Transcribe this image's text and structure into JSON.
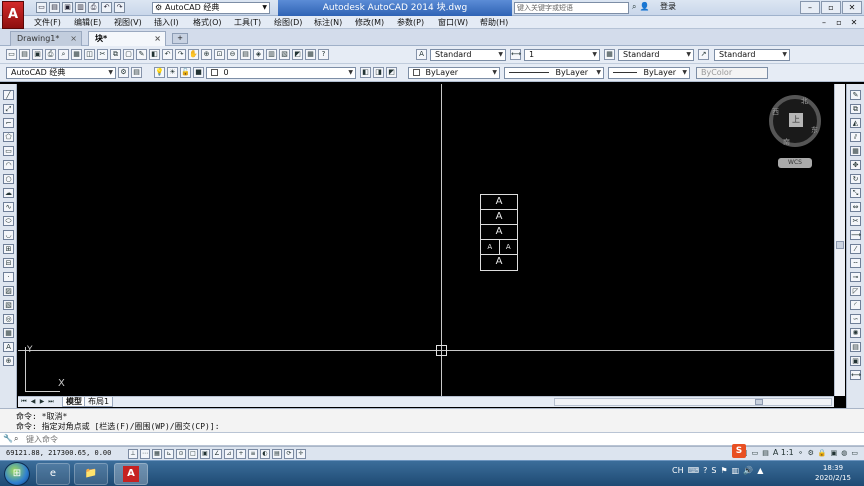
{
  "app": {
    "logo": "A",
    "workspace": "AutoCAD 经典",
    "title": "Autodesk AutoCAD 2014    块.dwg",
    "search_placeholder": "键入关键字或短语",
    "login": "登录"
  },
  "menu": {
    "items": [
      "文件(F)",
      "编辑(E)",
      "视图(V)",
      "插入(I)",
      "格式(O)",
      "工具(T)",
      "绘图(D)",
      "标注(N)",
      "修改(M)",
      "参数(P)",
      "窗口(W)",
      "帮助(H)"
    ]
  },
  "tabs": {
    "items": [
      {
        "label": "Drawing1*",
        "close": "×"
      },
      {
        "label": "块*",
        "close": "×"
      }
    ],
    "add": "+"
  },
  "toolbar1": {
    "text_style": "Standard",
    "dim_style": "1",
    "table_style": "Standard",
    "multileader_style": "Standard"
  },
  "toolbar2": {
    "workspace": "AutoCAD 经典",
    "layer": "0",
    "color": "ByLayer",
    "linetype": "ByLayer",
    "lineweight": "ByLayer",
    "plotstyle": "ByColor"
  },
  "canvas": {
    "ucs_x": "X",
    "ucs_y": "Y",
    "block_rows": [
      [
        "A"
      ],
      [
        "A"
      ],
      [
        "A"
      ],
      [
        "A",
        "A"
      ],
      [
        "A"
      ]
    ]
  },
  "viewcube": {
    "north": "北",
    "east": "东",
    "west": "西",
    "south": "南",
    "face": "上",
    "wcs": "WCS"
  },
  "layout_tabs": {
    "model": "模型",
    "layout1": "布局1"
  },
  "command": {
    "history1": "命令: *取消*",
    "history2": "命令: 指定对角点或 [栏选(F)/圈围(WP)/圈交(CP)]:",
    "placeholder": "键入命令"
  },
  "status": {
    "coords": "69121.88, 217300.65, 0.00",
    "scale": "A 1:1"
  },
  "taskbar": {
    "lang": "CH",
    "time": "18:39",
    "date": "2020/2/15"
  }
}
